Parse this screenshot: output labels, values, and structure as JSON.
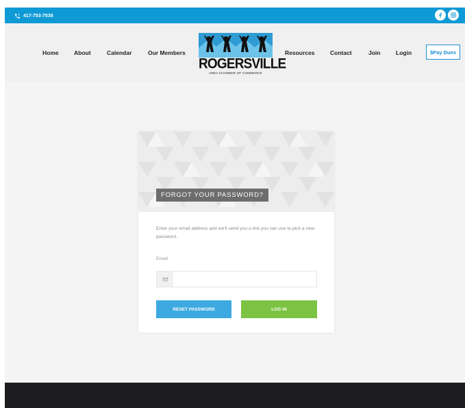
{
  "topbar": {
    "phone": "417-753-7538",
    "social": [
      "facebook-icon",
      "instagram-icon"
    ]
  },
  "nav": {
    "left": [
      "Home",
      "About",
      "Calendar",
      "Our Members"
    ],
    "right": [
      "Resources",
      "Contact",
      "Join",
      "Login"
    ],
    "pay_dues": "$Pay Dues"
  },
  "logo": {
    "title": "ROGERSVILLE",
    "subtitle": "AREA CHAMBER OF COMMERCE"
  },
  "form": {
    "title": "FORGOT YOUR PASSWORD?",
    "description": "Enter your email address and we'll send you a link you can use to pick a new password.",
    "email_label": "Email",
    "email_value": "",
    "email_placeholder": "",
    "reset_label": "RESET PASSWORD",
    "login_label": "LOG IN"
  },
  "colors": {
    "brand_blue": "#0f9ad5",
    "reset_button": "#3ea9e0",
    "login_button": "#7cc243",
    "footer": "#1d1d1f"
  }
}
